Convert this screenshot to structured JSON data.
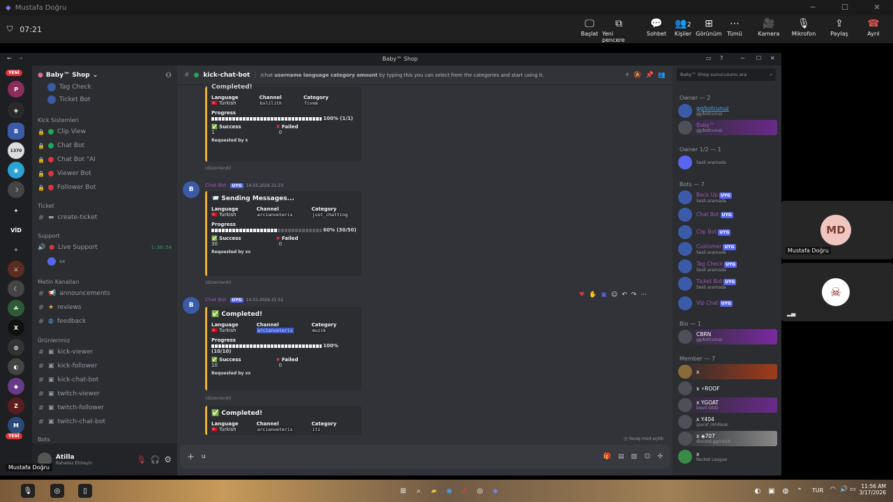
{
  "outer_window": {
    "title": "Mustafa Doğru"
  },
  "meeting": {
    "timer": "07:21",
    "buttons": [
      {
        "label": "Başlat",
        "icon": "screen-icon"
      },
      {
        "label": "Yeni pencere",
        "icon": "popout-icon"
      },
      {
        "label": "Sohbet",
        "icon": "chat-icon"
      },
      {
        "label": "Kişiler",
        "icon": "people-icon",
        "count": "2"
      },
      {
        "label": "Görünüm",
        "icon": "grid-icon"
      },
      {
        "label": "Tümü",
        "icon": "more-icon"
      },
      {
        "label": "Kamera",
        "icon": "camera-icon"
      },
      {
        "label": "Mikrofon",
        "icon": "mic-icon"
      },
      {
        "label": "Paylaş",
        "icon": "share-icon"
      },
      {
        "label": "Ayrıl",
        "icon": "hangup-icon"
      }
    ],
    "participants": [
      {
        "initials": "MD",
        "name": "Mustafa Doğru"
      }
    ],
    "tooltip": "Mustafa Doğru"
  },
  "discord": {
    "window_title": "Baby™ Shop",
    "server_name": "Baby™ Shop",
    "guild_badges": {
      "new_top": "YENİ",
      "new_bottom": "YENİ",
      "vid": "VİD",
      "num": "1370"
    },
    "channels": {
      "top_items": [
        {
          "label": "Tag Check"
        },
        {
          "label": "Ticket Bot"
        }
      ],
      "categories": [
        {
          "name": "Kick Sistemleri",
          "items": [
            "Clip View",
            "Chat Bot",
            "Chat Bot \"AI",
            "Viewer Bot",
            "Follower Bot"
          ]
        },
        {
          "name": "Ticket",
          "items": [
            "create-ticket"
          ]
        },
        {
          "name": "Support",
          "items": [
            "Live Support"
          ],
          "live_time": "1:36:54",
          "voice_user": "xx"
        },
        {
          "name": "Metin Kanalları",
          "items": [
            "announcements",
            "reviews",
            "feedback"
          ]
        },
        {
          "name": "Ürünlerimiz",
          "items": [
            "kick-viewer",
            "kick-follower",
            "kick-chat-bot",
            "twitch-viewer",
            "twitch-follower",
            "twitch-chat-bot"
          ]
        },
        {
          "name": "Bots",
          "items": []
        }
      ]
    },
    "user": {
      "name": "Atilla",
      "status": "Rahatsız Etmeyin"
    },
    "chat": {
      "channel": "kick-chat-bot",
      "topic_cmd": "/chat",
      "topic_bold": "username language category amount",
      "topic_rest": "by typing this you can select from the categories and start using it.",
      "search_placeholder": "Baby™ Shop sunucusunu ara",
      "composer_value": "u",
      "slow_mode": "Yavaş mod açıldı",
      "messages": [
        {
          "title": "Completed!",
          "language": "Turkish",
          "channel": "bxlilith",
          "category": "fivem",
          "percent": "100% (1/1)",
          "fill": 1.0,
          "success": "1",
          "failed": "0",
          "requested": "Requested by x",
          "edited": "(düzenlendi)"
        },
        {
          "author": "Chat Bot",
          "tag": "UYG",
          "time": "14.03.2026 21:23",
          "title": "Sending Messages...",
          "language": "Turkish",
          "channel": "arcianveteris",
          "category": "just_chatting",
          "percent": "60% (30/50)",
          "fill": 0.6,
          "success": "30",
          "failed": "0",
          "requested": "Requested by xx",
          "edited": "(düzenlendi)"
        },
        {
          "author": "Chat Bot",
          "tag": "UYG",
          "time": "14.03.2026 21:51",
          "title": "Completed!",
          "language": "Turkish",
          "channel": "arcianveteris",
          "category": "muzik",
          "percent": "100% (10/10)",
          "fill": 1.0,
          "success": "10",
          "failed": "0",
          "requested": "Requested by xx",
          "edited": "(düzenlendi)"
        },
        {
          "title": "Completed!",
          "language": "Turkish",
          "channel": "arcianveteris",
          "category": "iti"
        }
      ],
      "labels": {
        "language": "Language",
        "channel": "Channel",
        "category": "Category",
        "progress": "Progress",
        "success": "Success",
        "failed": "Failed"
      }
    },
    "members": {
      "sections": [
        {
          "title": "Owner — 2"
        },
        {
          "title": "Owner 1/2 — 1"
        },
        {
          "title": "Bots — 7"
        },
        {
          "title": "Bio — 1"
        },
        {
          "title": "Member — 7"
        }
      ],
      "owner": [
        {
          "name": "gg/botcunuz",
          "sub": "gg/botcunuz"
        },
        {
          "name": "Baby™",
          "sub": "gg/botcunuz"
        }
      ],
      "owner12": [
        {
          "name": "",
          "sub": "Sesli aramada"
        }
      ],
      "bots": [
        {
          "name": "Back Up",
          "sub": "Sesli aramada"
        },
        {
          "name": "Chat Bot",
          "sub": ""
        },
        {
          "name": "Clip Bot",
          "sub": ""
        },
        {
          "name": "Customer",
          "sub": "Sesli aramada"
        },
        {
          "name": "Tag Check",
          "sub": "Sesli aramada"
        },
        {
          "name": "Ticket Bot",
          "sub": "Sesli aramada"
        },
        {
          "name": "Vip Chat",
          "sub": ""
        }
      ],
      "bio": [
        {
          "name": "CBRN",
          "sub": "gg/botcunuz"
        }
      ],
      "member": [
        {
          "name": "x",
          "sub": ""
        },
        {
          "name": "x",
          "sub": "ROOF"
        },
        {
          "name": "x",
          "sub": "GOAT",
          "sub2": "Devil GOD"
        },
        {
          "name": "x",
          "sub": "404",
          "sub2": "/paraf /404leak"
        },
        {
          "name": "x",
          "sub": "707",
          "sub2": "discord.gg/ceich"
        },
        {
          "name": "x",
          "sub": "Rocket League"
        }
      ]
    }
  },
  "taskbar": {
    "lang": "TUR",
    "time": "11:56 AM",
    "date": "3/17/2026"
  }
}
